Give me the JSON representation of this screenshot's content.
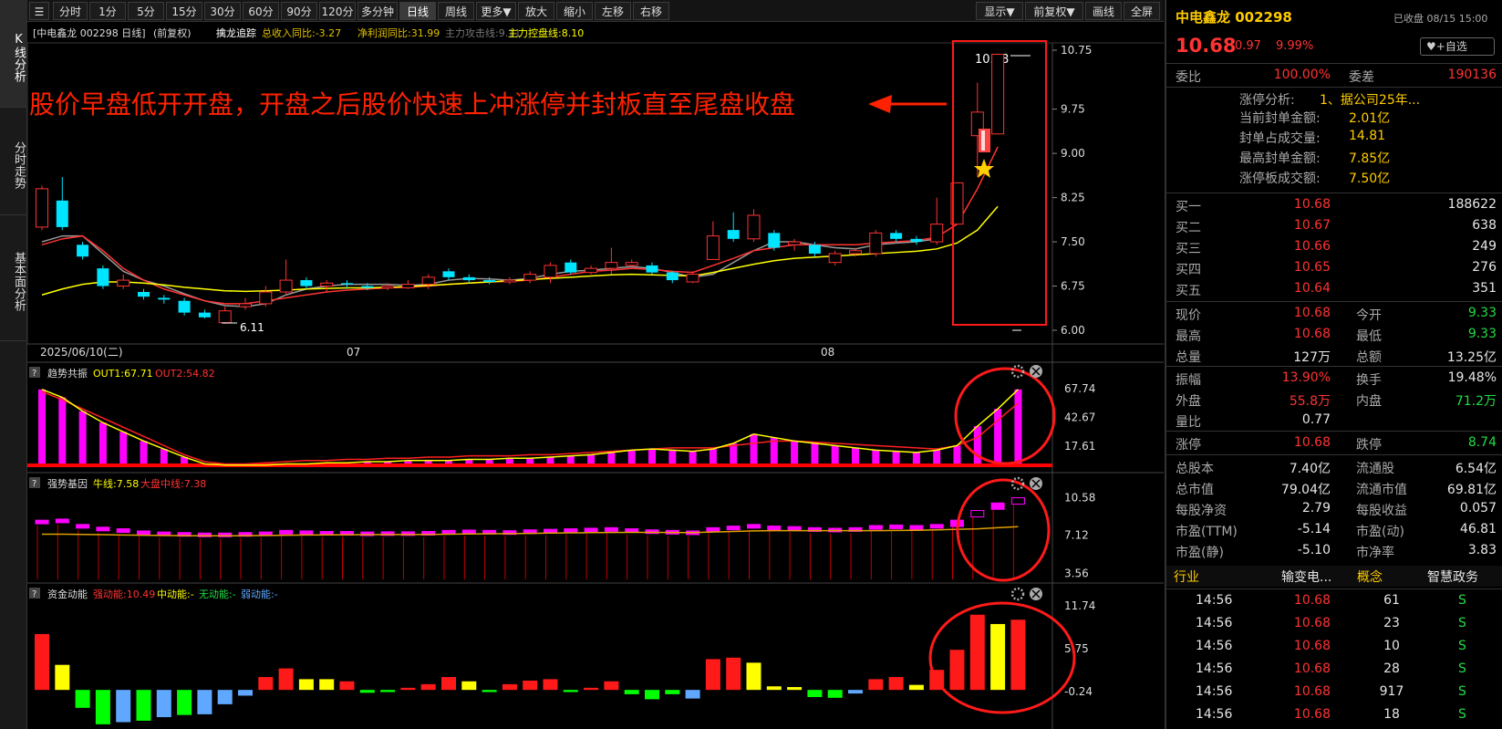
{
  "vtabs": [
    "K线分析",
    "分时走势",
    "基本面分析"
  ],
  "toolbar": {
    "left": [
      "分时",
      "1分",
      "5分",
      "15分",
      "30分",
      "60分",
      "90分",
      "120分",
      "多分钟",
      "日线",
      "周线",
      "更多▼",
      "放大",
      "缩小",
      "左移",
      "右移"
    ],
    "active": "日线",
    "right": [
      "显示▼",
      "前复权▼",
      "画线",
      "全屏"
    ]
  },
  "main_header": {
    "title": "[中电鑫龙 002298 日线]",
    "adj": "(前复权)",
    "indicator": "擒龙追踪",
    "f1": "总收入同比:-3.27",
    "f2": "净利润同比:31.99",
    "f3": "主力攻击线:9.11",
    "f4": "主力控盘线:8.10"
  },
  "annotation_text": "股价早盘低开开盘，开盘之后股价快速上冲涨停并封板直至尾盘收盘",
  "price_labels": {
    "high": "10.68",
    "low": "6.11"
  },
  "dates": [
    "2025/06/10(二)",
    "07",
    "08"
  ],
  "sub1": {
    "name": "趋势共振",
    "out1": "OUT1:67.71",
    "out2": "OUT2:54.82"
  },
  "sub2": {
    "name": "强势基因",
    "l1": "牛线:7.58",
    "l2": "大盘中线:7.38"
  },
  "sub3": {
    "name": "资金动能",
    "l1": "强动能:10.49",
    "l2": "中动能:-",
    "l3": "无动能:-",
    "l4": "弱动能:-"
  },
  "colors": {
    "up": "#ff3333",
    "down": "#00e5ff",
    "ma_yellow": "#ffff00",
    "ma_gray": "#999999",
    "magenta": "#ff00ff",
    "bg": "#000000",
    "annotation": "#ff2200"
  },
  "chart_data": {
    "type": "candlestick",
    "y_ticks": [
      10.75,
      9.75,
      9.0,
      8.25,
      7.5,
      6.75,
      6.0
    ],
    "candles": [
      {
        "o": 7.75,
        "c": 8.4,
        "h": 8.45,
        "l": 7.7
      },
      {
        "o": 8.2,
        "c": 7.75,
        "h": 8.6,
        "l": 7.7
      },
      {
        "o": 7.45,
        "c": 7.25,
        "h": 7.5,
        "l": 7.2
      },
      {
        "o": 7.05,
        "c": 6.75,
        "h": 7.1,
        "l": 6.7
      },
      {
        "o": 6.75,
        "c": 6.85,
        "h": 6.95,
        "l": 6.7
      },
      {
        "o": 6.65,
        "c": 6.57,
        "h": 6.7,
        "l": 6.52
      },
      {
        "o": 6.55,
        "c": 6.52,
        "h": 6.6,
        "l": 6.45
      },
      {
        "o": 6.5,
        "c": 6.3,
        "h": 6.55,
        "l": 6.25
      },
      {
        "o": 6.3,
        "c": 6.22,
        "h": 6.35,
        "l": 6.2
      },
      {
        "o": 6.13,
        "c": 6.33,
        "h": 6.4,
        "l": 6.11
      },
      {
        "o": 6.4,
        "c": 6.45,
        "h": 6.55,
        "l": 6.35
      },
      {
        "o": 6.45,
        "c": 6.65,
        "h": 6.75,
        "l": 6.4
      },
      {
        "o": 6.65,
        "c": 6.85,
        "h": 7.2,
        "l": 6.6
      },
      {
        "o": 6.85,
        "c": 6.75,
        "h": 6.9,
        "l": 6.7
      },
      {
        "o": 6.75,
        "c": 6.8,
        "h": 6.85,
        "l": 6.65
      },
      {
        "o": 6.8,
        "c": 6.78,
        "h": 6.85,
        "l": 6.7
      },
      {
        "o": 6.75,
        "c": 6.72,
        "h": 6.8,
        "l": 6.68
      },
      {
        "o": 6.72,
        "c": 6.75,
        "h": 6.8,
        "l": 6.68
      },
      {
        "o": 6.72,
        "c": 6.78,
        "h": 6.85,
        "l": 6.7
      },
      {
        "o": 6.78,
        "c": 6.9,
        "h": 6.95,
        "l": 6.7
      },
      {
        "o": 7.0,
        "c": 6.9,
        "h": 7.05,
        "l": 6.85
      },
      {
        "o": 6.9,
        "c": 6.85,
        "h": 6.95,
        "l": 6.8
      },
      {
        "o": 6.85,
        "c": 6.82,
        "h": 6.9,
        "l": 6.78
      },
      {
        "o": 6.82,
        "c": 6.85,
        "h": 6.9,
        "l": 6.78
      },
      {
        "o": 6.85,
        "c": 6.95,
        "h": 7.0,
        "l": 6.8
      },
      {
        "o": 6.9,
        "c": 7.1,
        "h": 7.15,
        "l": 6.8
      },
      {
        "o": 7.15,
        "c": 6.98,
        "h": 7.2,
        "l": 6.95
      },
      {
        "o": 6.98,
        "c": 7.05,
        "h": 7.1,
        "l": 6.95
      },
      {
        "o": 7.05,
        "c": 7.15,
        "h": 7.4,
        "l": 6.95
      },
      {
        "o": 7.1,
        "c": 7.15,
        "h": 7.2,
        "l": 7.05
      },
      {
        "o": 7.1,
        "c": 6.98,
        "h": 7.15,
        "l": 6.95
      },
      {
        "o": 6.98,
        "c": 6.85,
        "h": 7.0,
        "l": 6.8
      },
      {
        "o": 6.82,
        "c": 6.95,
        "h": 7.0,
        "l": 6.8
      },
      {
        "o": 7.2,
        "c": 7.6,
        "h": 7.85,
        "l": 7.2
      },
      {
        "o": 7.7,
        "c": 7.55,
        "h": 8.0,
        "l": 7.5
      },
      {
        "o": 7.55,
        "c": 7.95,
        "h": 8.05,
        "l": 7.5
      },
      {
        "o": 7.65,
        "c": 7.4,
        "h": 7.7,
        "l": 7.35
      },
      {
        "o": 7.45,
        "c": 7.5,
        "h": 7.55,
        "l": 7.35
      },
      {
        "o": 7.45,
        "c": 7.3,
        "h": 7.5,
        "l": 7.25
      },
      {
        "o": 7.15,
        "c": 7.3,
        "h": 7.35,
        "l": 7.1
      },
      {
        "o": 7.3,
        "c": 7.35,
        "h": 7.4,
        "l": 7.25
      },
      {
        "o": 7.3,
        "c": 7.65,
        "h": 7.7,
        "l": 7.25
      },
      {
        "o": 7.65,
        "c": 7.55,
        "h": 7.7,
        "l": 7.5
      },
      {
        "o": 7.55,
        "c": 7.5,
        "h": 7.6,
        "l": 7.45
      },
      {
        "o": 7.5,
        "c": 7.8,
        "h": 8.25,
        "l": 7.45
      },
      {
        "o": 7.8,
        "c": 8.5,
        "h": 8.5,
        "l": 7.8
      },
      {
        "o": 9.3,
        "c": 9.7,
        "h": 10.2,
        "l": 8.6
      },
      {
        "o": 9.33,
        "c": 10.68,
        "h": 10.68,
        "l": 9.33
      }
    ],
    "ma_yellow": [
      6.6,
      6.7,
      6.78,
      6.82,
      6.82,
      6.8,
      6.77,
      6.73,
      6.7,
      6.67,
      6.66,
      6.67,
      6.68,
      6.7,
      6.71,
      6.72,
      6.72,
      6.73,
      6.74,
      6.76,
      6.78,
      6.8,
      6.82,
      6.84,
      6.86,
      6.88,
      6.9,
      6.92,
      6.94,
      6.95,
      6.94,
      6.93,
      6.92,
      6.98,
      7.05,
      7.12,
      7.18,
      7.22,
      7.24,
      7.26,
      7.28,
      7.3,
      7.32,
      7.34,
      7.38,
      7.48,
      7.7,
      8.1
    ],
    "ma_red": [
      7.45,
      7.55,
      7.6,
      7.35,
      7.05,
      6.85,
      6.7,
      6.6,
      6.5,
      6.45,
      6.45,
      6.5,
      6.55,
      6.6,
      6.65,
      6.68,
      6.7,
      6.72,
      6.73,
      6.75,
      6.78,
      6.8,
      6.82,
      6.83,
      6.85,
      6.9,
      6.95,
      7.0,
      7.02,
      7.05,
      7.03,
      7.0,
      6.98,
      7.1,
      7.22,
      7.35,
      7.4,
      7.45,
      7.45,
      7.45,
      7.45,
      7.48,
      7.5,
      7.52,
      7.58,
      7.8,
      8.4,
      9.11
    ],
    "ma_gray": [
      7.5,
      7.6,
      7.6,
      7.3,
      7.0,
      6.85,
      6.75,
      6.62,
      6.5,
      6.42,
      6.4,
      6.45,
      6.6,
      6.7,
      6.75,
      6.78,
      6.78,
      6.78,
      6.76,
      6.78,
      6.85,
      6.88,
      6.87,
      6.85,
      6.88,
      6.95,
      7.0,
      7.02,
      7.05,
      7.08,
      7.05,
      6.98,
      6.9,
      6.95,
      7.15,
      7.35,
      7.5,
      7.5,
      7.45,
      7.4,
      7.38,
      7.45,
      7.48,
      7.5,
      7.55,
      null,
      null,
      null
    ],
    "sub1_ticks": [
      67.74,
      42.67,
      17.61
    ],
    "sub1_bars": [
      67,
      60,
      48,
      38,
      30,
      22,
      15,
      8,
      2,
      1,
      1,
      1,
      2,
      2,
      3,
      3,
      4,
      4,
      5,
      5,
      5,
      6,
      6,
      7,
      7,
      8,
      9,
      10,
      12,
      14,
      15,
      14,
      13,
      15,
      20,
      28,
      25,
      22,
      20,
      18,
      16,
      14,
      13,
      12,
      14,
      18,
      35,
      50,
      67
    ],
    "sub1_out2": [
      65,
      58,
      50,
      42,
      34,
      26,
      18,
      10,
      4,
      2,
      2,
      3,
      4,
      5,
      5,
      6,
      6,
      7,
      7,
      8,
      8,
      9,
      9,
      9,
      10,
      10,
      11,
      12,
      13,
      14,
      15,
      16,
      16,
      16,
      18,
      20,
      22,
      22,
      21,
      20,
      19,
      18,
      17,
      16,
      15,
      18,
      25,
      40,
      55
    ],
    "sub2_ticks": [
      10.58,
      7.12,
      3.56
    ],
    "sub2_boxes": [
      8.5,
      8.6,
      8.1,
      7.85,
      7.7,
      7.5,
      7.4,
      7.35,
      7.3,
      7.3,
      7.35,
      7.4,
      7.55,
      7.5,
      7.45,
      7.45,
      7.4,
      7.42,
      7.42,
      7.45,
      7.55,
      7.58,
      7.55,
      7.52,
      7.6,
      7.65,
      7.7,
      7.75,
      7.8,
      7.7,
      7.6,
      7.55,
      7.5,
      7.8,
      7.95,
      8.1,
      7.95,
      7.9,
      7.8,
      7.75,
      7.8,
      8.0,
      8.05,
      8.0,
      8.1,
      8.5,
      9.4,
      10.1,
      10.58
    ],
    "sub2_line": [
      7.2,
      7.2,
      7.18,
      7.15,
      7.12,
      7.1,
      7.08,
      7.06,
      7.05,
      7.05,
      7.06,
      7.08,
      7.1,
      7.12,
      7.13,
      7.14,
      7.15,
      7.16,
      7.17,
      7.18,
      7.2,
      7.22,
      7.24,
      7.25,
      7.27,
      7.3,
      7.32,
      7.34,
      7.36,
      7.37,
      7.37,
      7.36,
      7.35,
      7.4,
      7.45,
      7.5,
      7.52,
      7.53,
      7.53,
      7.52,
      7.52,
      7.53,
      7.55,
      7.56,
      7.6,
      7.65,
      7.7,
      7.8,
      7.9
    ],
    "sub3_ticks": [
      11.74,
      5.75,
      -0.24
    ],
    "sub3_bars": [
      {
        "v": 7.8,
        "c": "#ff1a1a"
      },
      {
        "v": 3.5,
        "c": "#ffff00"
      },
      {
        "v": -2.5,
        "c": "#00ff00"
      },
      {
        "v": -4.8,
        "c": "#00ff00"
      },
      {
        "v": -4.5,
        "c": "#60a8ff"
      },
      {
        "v": -4.3,
        "c": "#00ff00"
      },
      {
        "v": -3.8,
        "c": "#60a8ff"
      },
      {
        "v": -3.5,
        "c": "#00ff00"
      },
      {
        "v": -3.4,
        "c": "#60a8ff"
      },
      {
        "v": -2.0,
        "c": "#60a8ff"
      },
      {
        "v": -0.8,
        "c": "#60a8ff"
      },
      {
        "v": 1.8,
        "c": "#ff1a1a"
      },
      {
        "v": 3.0,
        "c": "#ff1a1a"
      },
      {
        "v": 1.5,
        "c": "#ffff00"
      },
      {
        "v": 1.5,
        "c": "#ffff00"
      },
      {
        "v": 1.2,
        "c": "#ff1a1a"
      },
      {
        "v": -0.4,
        "c": "#00ff00"
      },
      {
        "v": -0.3,
        "c": "#00ff00"
      },
      {
        "v": 0.3,
        "c": "#ff1a1a"
      },
      {
        "v": 0.8,
        "c": "#ff1a1a"
      },
      {
        "v": 1.8,
        "c": "#ff1a1a"
      },
      {
        "v": 1.2,
        "c": "#ffff00"
      },
      {
        "v": -0.3,
        "c": "#00ff00"
      },
      {
        "v": 0.8,
        "c": "#ff1a1a"
      },
      {
        "v": 1.3,
        "c": "#ff1a1a"
      },
      {
        "v": 1.5,
        "c": "#ff1a1a"
      },
      {
        "v": -0.3,
        "c": "#00ff00"
      },
      {
        "v": 0.3,
        "c": "#ff1a1a"
      },
      {
        "v": 1.2,
        "c": "#ff1a1a"
      },
      {
        "v": -0.6,
        "c": "#00ff00"
      },
      {
        "v": -1.3,
        "c": "#00ff00"
      },
      {
        "v": -0.6,
        "c": "#00ff00"
      },
      {
        "v": -1.2,
        "c": "#60a8ff"
      },
      {
        "v": 4.3,
        "c": "#ff1a1a"
      },
      {
        "v": 4.5,
        "c": "#ff1a1a"
      },
      {
        "v": 3.8,
        "c": "#ffff00"
      },
      {
        "v": 0.5,
        "c": "#ffff00"
      },
      {
        "v": 0.4,
        "c": "#ffff00"
      },
      {
        "v": -1.0,
        "c": "#00ff00"
      },
      {
        "v": -1.1,
        "c": "#00ff00"
      },
      {
        "v": -0.5,
        "c": "#60a8ff"
      },
      {
        "v": 1.5,
        "c": "#ff1a1a"
      },
      {
        "v": 1.8,
        "c": "#ff1a1a"
      },
      {
        "v": 0.7,
        "c": "#ffff00"
      },
      {
        "v": 2.8,
        "c": "#ff1a1a"
      },
      {
        "v": 5.6,
        "c": "#ff1a1a"
      },
      {
        "v": 10.5,
        "c": "#ff1a1a"
      },
      {
        "v": 9.2,
        "c": "#ffff00"
      },
      {
        "v": 9.8,
        "c": "#ff1a1a"
      }
    ]
  },
  "rpanel": {
    "stock": "中电鑫龙 002298",
    "status": "已收盘 08/15 15:00",
    "price": "10.68",
    "change": "0.97",
    "pct": "9.99%",
    "fav": "+自选",
    "weibi_label": "委比",
    "weibi": "100.00%",
    "weicha_label": "委差",
    "weicha": "190136",
    "zt_label": "涨停分析:",
    "zt": "1、据公司25年...",
    "info": [
      {
        "k": "当前封单金额:",
        "v": "2.01亿"
      },
      {
        "k": "封单占成交量:",
        "v": "14.81"
      },
      {
        "k": "最高封单金额:",
        "v": "7.85亿"
      },
      {
        "k": "涨停板成交额:",
        "v": "7.50亿"
      }
    ],
    "bids": [
      {
        "k": "买一",
        "p": "10.68",
        "v": "188622"
      },
      {
        "k": "买二",
        "p": "10.67",
        "v": "638"
      },
      {
        "k": "买三",
        "p": "10.66",
        "v": "249"
      },
      {
        "k": "买四",
        "p": "10.65",
        "v": "276"
      },
      {
        "k": "买五",
        "p": "10.64",
        "v": "351"
      }
    ],
    "stats1": [
      {
        "k1": "现价",
        "v1": "10.68",
        "c1": "red",
        "k2": "今开",
        "v2": "9.33",
        "c2": "green"
      },
      {
        "k1": "最高",
        "v1": "10.68",
        "c1": "red",
        "k2": "最低",
        "v2": "9.33",
        "c2": "green"
      },
      {
        "k1": "总量",
        "v1": "127万",
        "c1": "white",
        "k2": "总额",
        "v2": "13.25亿",
        "c2": "white"
      }
    ],
    "stats2": [
      {
        "k1": "振幅",
        "v1": "13.90%",
        "c1": "red",
        "k2": "换手",
        "v2": "19.48%",
        "c2": "white"
      },
      {
        "k1": "外盘",
        "v1": "55.8万",
        "c1": "red",
        "k2": "内盘",
        "v2": "71.2万",
        "c2": "green"
      },
      {
        "k1": "量比",
        "v1": "0.77",
        "c1": "white",
        "k2": "",
        "v2": "",
        "c2": "white"
      }
    ],
    "stats3": [
      {
        "k1": "涨停",
        "v1": "10.68",
        "c1": "red",
        "k2": "跌停",
        "v2": "8.74",
        "c2": "green"
      }
    ],
    "stats4": [
      {
        "k1": "总股本",
        "v1": "7.40亿",
        "k2": "流通股",
        "v2": "6.54亿"
      },
      {
        "k1": "总市值",
        "v1": "79.04亿",
        "k2": "流通市值",
        "v2": "69.81亿"
      },
      {
        "k1": "每股净资",
        "v1": "2.79",
        "k2": "每股收益",
        "v2": "0.057"
      },
      {
        "k1": "市盈(TTM)",
        "v1": "-5.14",
        "k2": "市盈(动)",
        "v2": "46.81"
      },
      {
        "k1": "市盈(静)",
        "v1": "-5.10",
        "k2": "市净率",
        "v2": "3.83"
      }
    ],
    "industry": {
      "k1": "行业",
      "v1": "输变电...",
      "k2": "概念",
      "v2": "智慧政务"
    },
    "trades": [
      {
        "t": "14:56",
        "p": "10.68",
        "v": "61",
        "s": "S"
      },
      {
        "t": "14:56",
        "p": "10.68",
        "v": "23",
        "s": "S"
      },
      {
        "t": "14:56",
        "p": "10.68",
        "v": "10",
        "s": "S"
      },
      {
        "t": "14:56",
        "p": "10.68",
        "v": "28",
        "s": "S"
      },
      {
        "t": "14:56",
        "p": "10.68",
        "v": "917",
        "s": "S"
      },
      {
        "t": "14:56",
        "p": "10.68",
        "v": "18",
        "s": "S"
      }
    ]
  }
}
